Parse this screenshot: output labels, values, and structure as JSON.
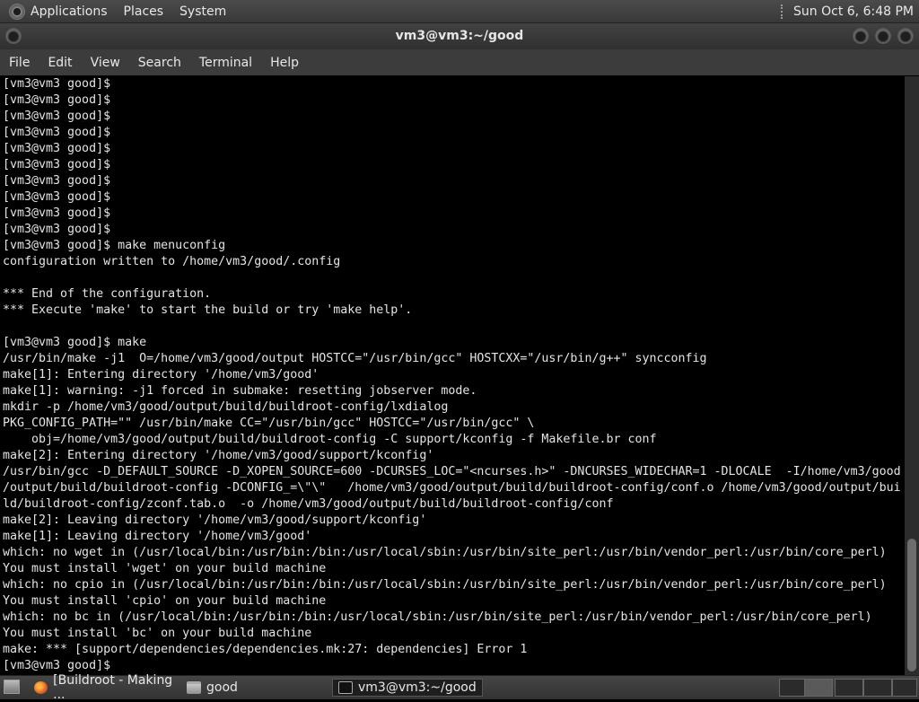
{
  "top_panel": {
    "menus": [
      "Applications",
      "Places",
      "System"
    ],
    "clock": "Sun Oct  6,  6:48 PM"
  },
  "window": {
    "title": "vm3@vm3:~/good"
  },
  "menubar": [
    "File",
    "Edit",
    "View",
    "Search",
    "Terminal",
    "Help"
  ],
  "terminal": {
    "lines": [
      "[vm3@vm3 good]$",
      "[vm3@vm3 good]$",
      "[vm3@vm3 good]$",
      "[vm3@vm3 good]$",
      "[vm3@vm3 good]$",
      "[vm3@vm3 good]$",
      "[vm3@vm3 good]$",
      "[vm3@vm3 good]$",
      "[vm3@vm3 good]$",
      "[vm3@vm3 good]$",
      "[vm3@vm3 good]$ make menuconfig",
      "configuration written to /home/vm3/good/.config",
      "",
      "*** End of the configuration.",
      "*** Execute 'make' to start the build or try 'make help'.",
      "",
      "[vm3@vm3 good]$ make",
      "/usr/bin/make -j1  O=/home/vm3/good/output HOSTCC=\"/usr/bin/gcc\" HOSTCXX=\"/usr/bin/g++\" syncconfig",
      "make[1]: Entering directory '/home/vm3/good'",
      "make[1]: warning: -j1 forced in submake: resetting jobserver mode.",
      "mkdir -p /home/vm3/good/output/build/buildroot-config/lxdialog",
      "PKG_CONFIG_PATH=\"\" /usr/bin/make CC=\"/usr/bin/gcc\" HOSTCC=\"/usr/bin/gcc\" \\",
      "    obj=/home/vm3/good/output/build/buildroot-config -C support/kconfig -f Makefile.br conf",
      "make[2]: Entering directory '/home/vm3/good/support/kconfig'",
      "/usr/bin/gcc -D_DEFAULT_SOURCE -D_XOPEN_SOURCE=600 -DCURSES_LOC=\"<ncurses.h>\" -DNCURSES_WIDECHAR=1 -DLOCALE  -I/home/vm3/good",
      "/output/build/buildroot-config -DCONFIG_=\\\"\\\"   /home/vm3/good/output/build/buildroot-config/conf.o /home/vm3/good/output/bui",
      "ld/buildroot-config/zconf.tab.o  -o /home/vm3/good/output/build/buildroot-config/conf",
      "make[2]: Leaving directory '/home/vm3/good/support/kconfig'",
      "make[1]: Leaving directory '/home/vm3/good'",
      "which: no wget in (/usr/local/bin:/usr/bin:/bin:/usr/local/sbin:/usr/bin/site_perl:/usr/bin/vendor_perl:/usr/bin/core_perl)",
      "You must install 'wget' on your build machine",
      "which: no cpio in (/usr/local/bin:/usr/bin:/bin:/usr/local/sbin:/usr/bin/site_perl:/usr/bin/vendor_perl:/usr/bin/core_perl)",
      "You must install 'cpio' on your build machine",
      "which: no bc in (/usr/local/bin:/usr/bin:/bin:/usr/local/sbin:/usr/bin/site_perl:/usr/bin/vendor_perl:/usr/bin/core_perl)",
      "You must install 'bc' on your build machine",
      "make: *** [support/dependencies/dependencies.mk:27: dependencies] Error 1",
      "[vm3@vm3 good]$"
    ]
  },
  "taskbar": {
    "tasks": [
      {
        "label": "[Buildroot - Making ...",
        "icon": "firefox-icon"
      },
      {
        "label": "good",
        "icon": "folder-icon"
      },
      {
        "label": "vm3@vm3:~/good",
        "icon": "terminal-icon"
      }
    ]
  }
}
